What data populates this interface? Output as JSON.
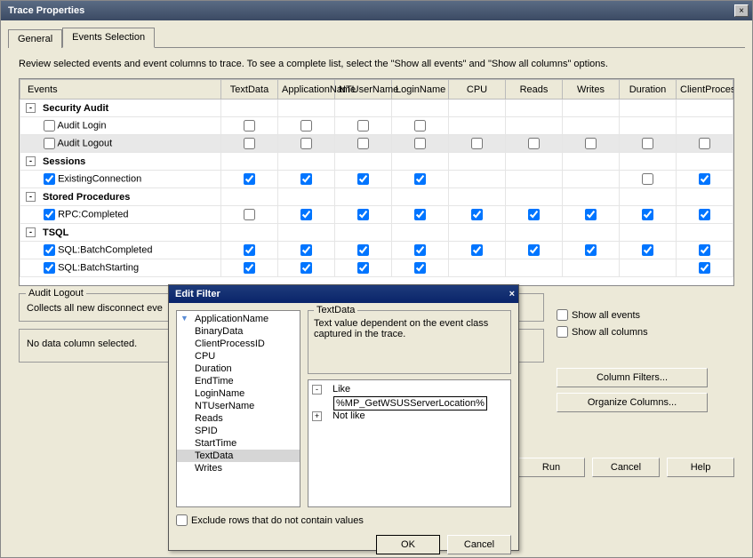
{
  "window": {
    "title": "Trace Properties",
    "close": "×"
  },
  "tabs": {
    "general": "General",
    "events": "Events Selection",
    "active": "events"
  },
  "instruction": "Review selected events and event columns to trace. To see a complete list, select the \"Show all events\" and \"Show all columns\" options.",
  "headers": [
    "Events",
    "TextData",
    "ApplicationName",
    "NTUserName",
    "LoginName",
    "CPU",
    "Reads",
    "Writes",
    "Duration",
    "ClientProcess"
  ],
  "events": [
    {
      "cat": true,
      "name": "Security Audit"
    },
    {
      "chk": false,
      "name": "Audit Login",
      "cells": [
        false,
        false,
        false,
        false,
        null,
        null,
        null,
        null,
        null
      ]
    },
    {
      "chk": false,
      "name": "Audit Logout",
      "sel": true,
      "cells": [
        false,
        false,
        false,
        false,
        false,
        false,
        false,
        false,
        false
      ]
    },
    {
      "cat": true,
      "name": "Sessions"
    },
    {
      "chk": true,
      "name": "ExistingConnection",
      "cells": [
        true,
        true,
        true,
        true,
        null,
        null,
        null,
        false,
        true
      ]
    },
    {
      "cat": true,
      "name": "Stored Procedures"
    },
    {
      "chk": true,
      "name": "RPC:Completed",
      "cells": [
        false,
        true,
        true,
        true,
        true,
        true,
        true,
        true,
        true
      ]
    },
    {
      "cat": true,
      "name": "TSQL"
    },
    {
      "chk": true,
      "name": "SQL:BatchCompleted",
      "cells": [
        true,
        true,
        true,
        true,
        true,
        true,
        true,
        true,
        true
      ]
    },
    {
      "chk": true,
      "name": "SQL:BatchStarting",
      "cells": [
        true,
        true,
        true,
        true,
        null,
        null,
        null,
        null,
        true
      ]
    }
  ],
  "detail_group": {
    "title": "Audit Logout",
    "desc": "Collects all new disconnect eve"
  },
  "nodata": "No data column selected.",
  "opts": {
    "show_events": "Show all events",
    "show_cols": "Show all columns",
    "filters": "Column Filters...",
    "organize": "Organize Columns..."
  },
  "footer": {
    "run": "Run",
    "cancel": "Cancel",
    "help": "Help"
  },
  "dialog": {
    "title": "Edit Filter",
    "close": "×",
    "columns": [
      "ApplicationName",
      "BinaryData",
      "ClientProcessID",
      "CPU",
      "Duration",
      "EndTime",
      "LoginName",
      "NTUserName",
      "Reads",
      "SPID",
      "StartTime",
      "TextData",
      "Writes"
    ],
    "selected_col": "TextData",
    "iconed_col": "ApplicationName",
    "field": {
      "label": "TextData",
      "desc": "Text value dependent on the event class captured in the trace."
    },
    "filter": {
      "like_label": "Like",
      "notlike_label": "Not like",
      "value": "%MP_GetWSUSServerLocation%"
    },
    "exclude": "Exclude rows that do not contain values",
    "ok": "OK",
    "cancel": "Cancel"
  }
}
